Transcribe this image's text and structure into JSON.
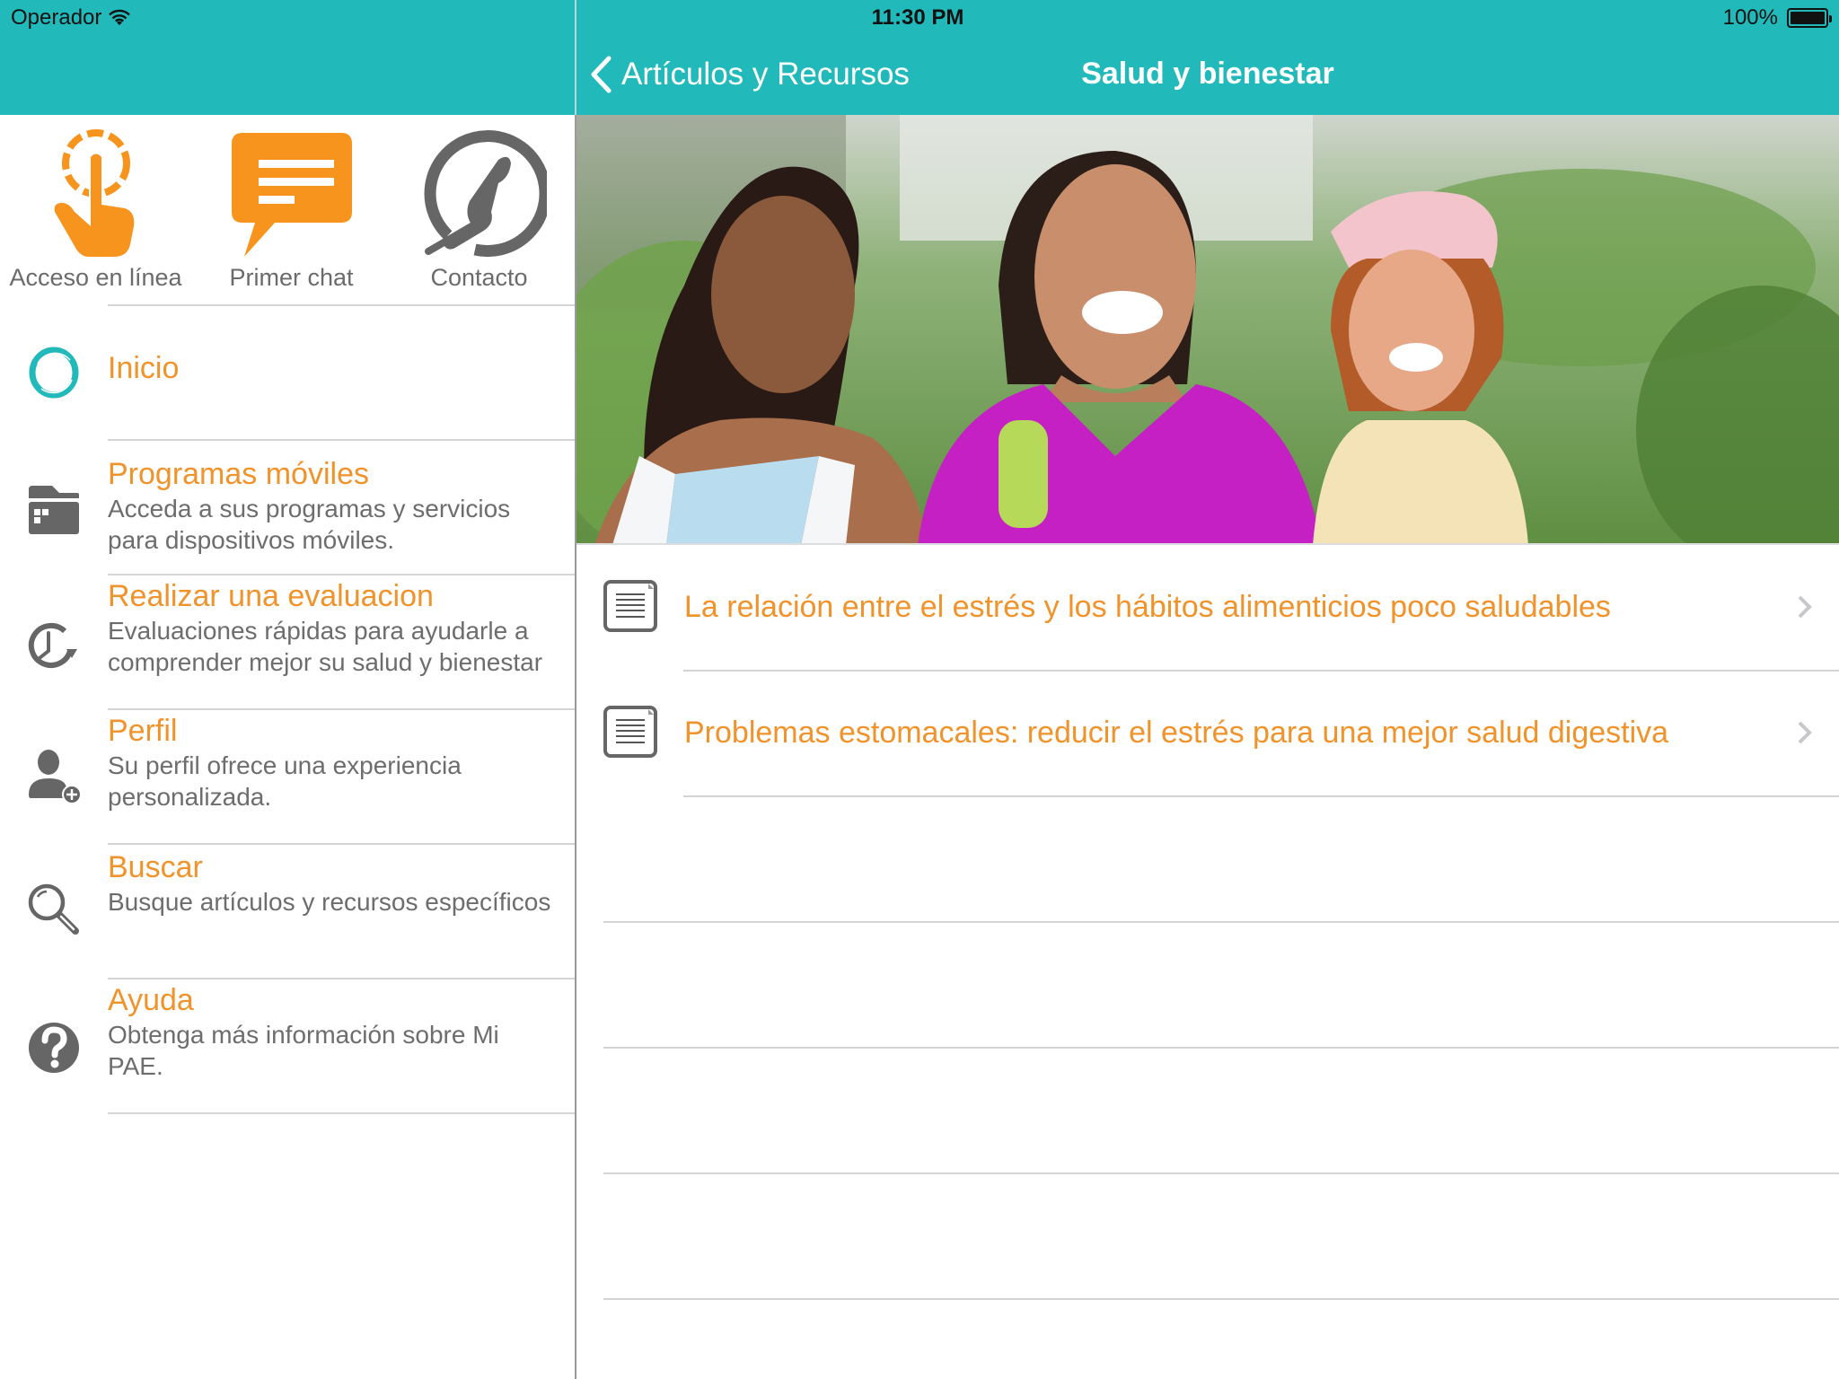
{
  "status_bar": {
    "carrier": "Operador",
    "time": "11:30 PM",
    "battery_text": "100%",
    "battery_level": 1.0
  },
  "nav": {
    "back_label": "Artículos y Recursos",
    "title": "Salud y bienestar"
  },
  "colors": {
    "header_bg": "#22b9ba",
    "accent_orange": "#f0932b",
    "icon_gray": "#666666",
    "text_gray": "#6d6d6d"
  },
  "quick_actions": [
    {
      "label": "Acceso en línea",
      "icon": "touch-hand-icon"
    },
    {
      "label": "Primer chat",
      "icon": "chat-bubble-icon"
    },
    {
      "label": "Contacto",
      "icon": "phone-icon"
    }
  ],
  "menu": [
    {
      "title": "Inicio",
      "description": "",
      "icon": "home-ring-icon"
    },
    {
      "title": "Programas móviles",
      "description": "Acceda a sus programas y servicios para dispositivos móviles.",
      "icon": "folder-apps-icon"
    },
    {
      "title": "Realizar una evaluacion",
      "description": "Evaluaciones rápidas para ayudarle a comprender mejor su salud y bienestar",
      "icon": "clock-refresh-icon"
    },
    {
      "title": "Perfil",
      "description": "Su perfil ofrece una experiencia personalizada.",
      "icon": "user-add-icon"
    },
    {
      "title": "Buscar",
      "description": "Busque artículos y recursos específicos",
      "icon": "search-icon"
    },
    {
      "title": "Ayuda",
      "description": "Obtenga más información sobre Mi PAE.",
      "icon": "help-icon"
    }
  ],
  "hero_image": {
    "description": "Three smiling women walking outdoors, one holding a green dumbbell"
  },
  "articles": [
    {
      "title": "La relación entre el estrés y los hábitos alimenticios poco saludables",
      "icon": "document-icon"
    },
    {
      "title": "Problemas estomacales: reducir el estrés para una mejor salud digestiva",
      "icon": "document-icon"
    }
  ]
}
